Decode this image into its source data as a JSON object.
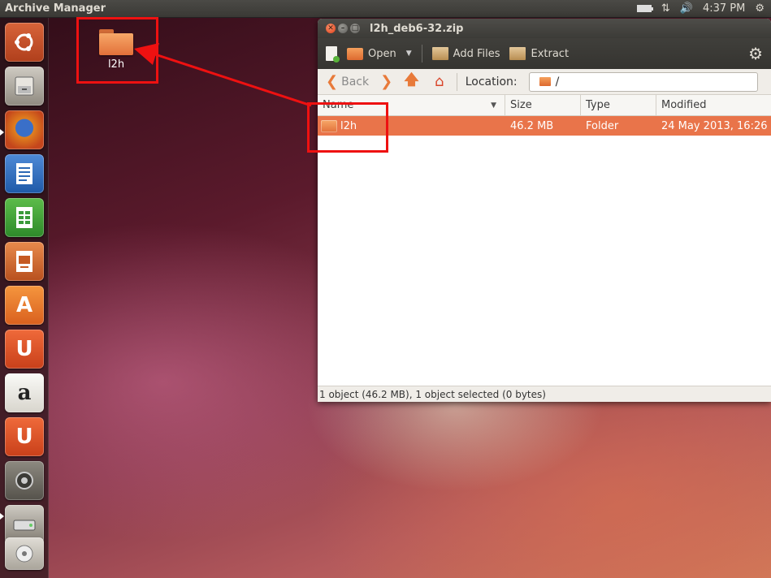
{
  "top_panel": {
    "app_title": "Archive Manager",
    "clock": "4:37 PM",
    "indicators": [
      "battery-icon",
      "network-icon",
      "volume-icon",
      "settings-gear-icon"
    ]
  },
  "launcher": {
    "items": [
      {
        "name": "dash-home",
        "icon": "ubuntu-logo-icon",
        "color": "#c9502a"
      },
      {
        "name": "files",
        "icon": "file-cabinet-icon",
        "color": "#9a958a"
      },
      {
        "name": "firefox",
        "icon": "firefox-icon",
        "color": "#e07a20"
      },
      {
        "name": "libreoffice-writer",
        "icon": "writer-icon",
        "color": "#2d69b5"
      },
      {
        "name": "libreoffice-calc",
        "icon": "calc-icon",
        "color": "#3a9a3a"
      },
      {
        "name": "libreoffice-impress",
        "icon": "impress-icon",
        "color": "#c65a22"
      },
      {
        "name": "software-center",
        "icon": "shopping-bag-icon",
        "color": "#e8782a"
      },
      {
        "name": "ubuntu-one",
        "icon": "ubuntu-one-icon",
        "color": "#e2562a"
      },
      {
        "name": "amazon",
        "icon": "amazon-icon",
        "color": "#e9e6de"
      },
      {
        "name": "ubuntu-one-music",
        "icon": "ubuntu-one-music-icon",
        "color": "#e2562a"
      },
      {
        "name": "system-settings",
        "icon": "settings-icon",
        "color": "#6d6a63"
      },
      {
        "name": "removable-drive",
        "icon": "drive-icon",
        "color": "#9a958a"
      }
    ]
  },
  "desktop": {
    "folder_label": "l2h"
  },
  "window": {
    "title": "l2h_deb6-32.zip",
    "toolbar": {
      "open_label": "Open",
      "add_files_label": "Add Files",
      "extract_label": "Extract"
    },
    "locbar": {
      "back_label": "Back",
      "location_label": "Location:",
      "location_value": "/"
    },
    "columns": {
      "name": "Name",
      "size": "Size",
      "type": "Type",
      "modified": "Modified"
    },
    "rows": [
      {
        "name": "l2h",
        "size": "46.2 MB",
        "type": "Folder",
        "modified": "24 May 2013, 16:26"
      }
    ],
    "status": "1 object (46.2 MB), 1 object selected (0 bytes)"
  },
  "colors": {
    "selection": "#e9744a",
    "annotation": "#ee1111"
  }
}
